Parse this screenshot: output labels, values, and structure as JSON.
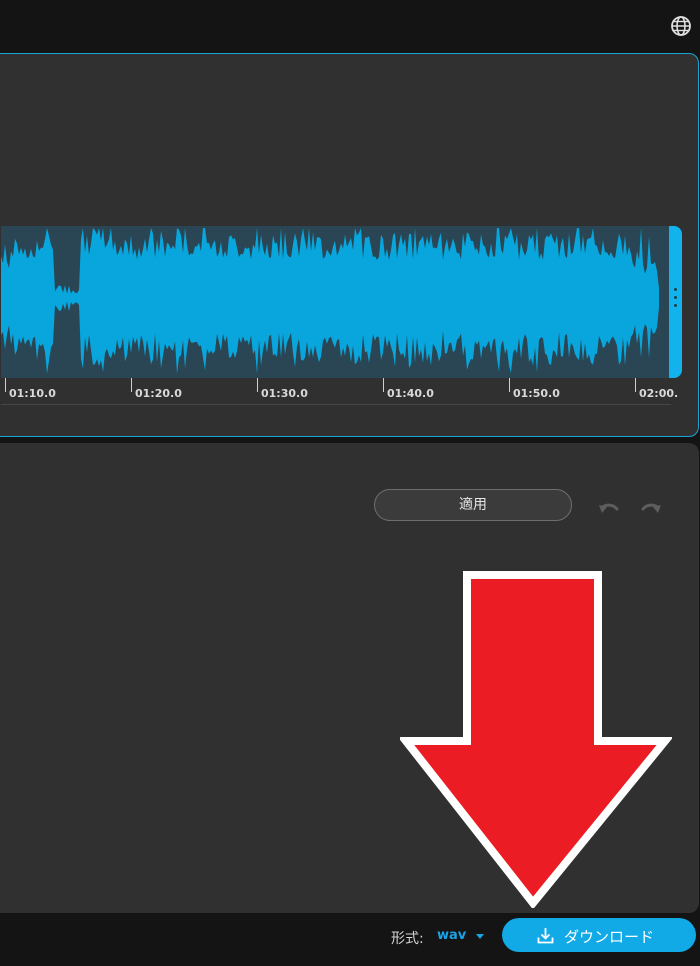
{
  "colors": {
    "accent": "#11a9e6",
    "waveform": "#08a6dc",
    "waveform_bg": "#2a4553",
    "panel": "#303030",
    "arrow_fill": "#ec1c24",
    "arrow_outline": "#ffffff"
  },
  "header": {
    "language_icon": "globe-icon"
  },
  "timeline": {
    "ticks": [
      "01:10.0",
      "01:20.0",
      "01:30.0",
      "01:40.0",
      "01:50.0",
      "02:00."
    ]
  },
  "editor": {
    "apply_label": "適用",
    "undo_icon": "undo-icon",
    "redo_icon": "redo-icon"
  },
  "annotation": {
    "icon": "big-red-down-arrow"
  },
  "footer": {
    "format_label": "形式:",
    "format_value": "wav",
    "download_label": "ダウンロード",
    "download_icon": "download-icon"
  }
}
